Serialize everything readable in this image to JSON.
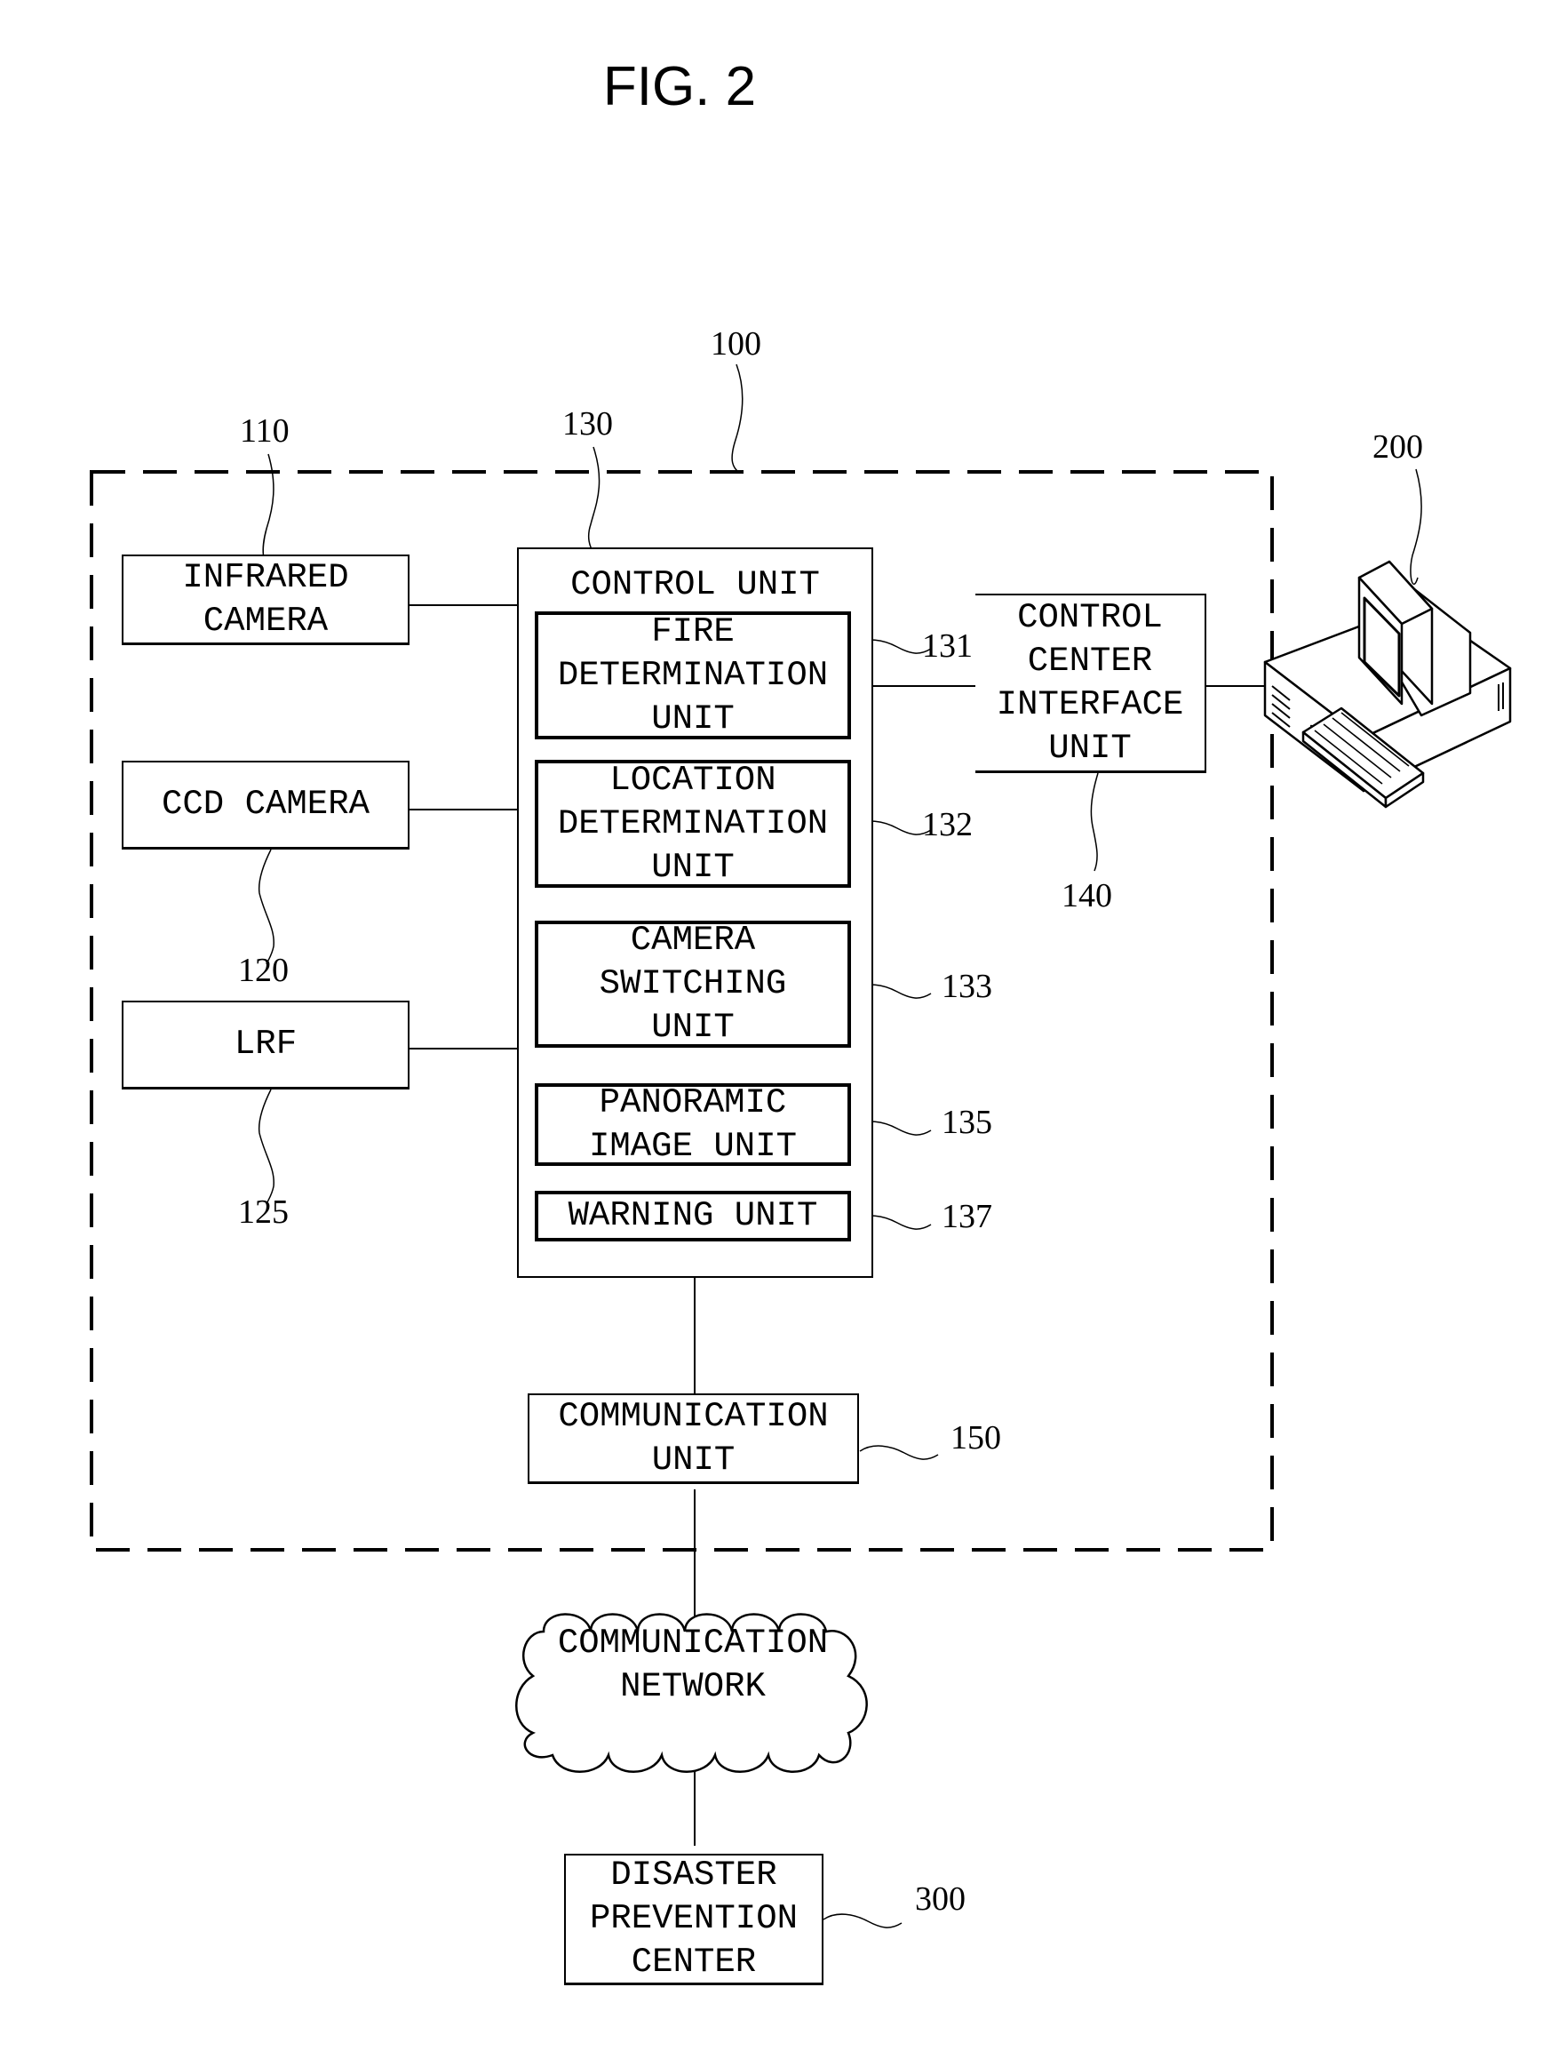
{
  "figure": {
    "title": "FIG. 2"
  },
  "system": {
    "ref": "100",
    "boundary": "dashed"
  },
  "components": {
    "infrared_camera": {
      "ref": "110",
      "lines": [
        "INFRARED",
        "CAMERA"
      ]
    },
    "ccd_camera": {
      "ref": "120",
      "lines": [
        "CCD CAMERA"
      ]
    },
    "lrf": {
      "ref": "125",
      "lines": [
        "LRF"
      ]
    },
    "control_unit": {
      "ref": "130",
      "label": "CONTROL UNIT",
      "subunits": [
        {
          "ref": "131",
          "lines": [
            "FIRE",
            "DETERMINATION",
            "UNIT"
          ]
        },
        {
          "ref": "132",
          "lines": [
            "LOCATION",
            "DETERMINATION",
            "UNIT"
          ]
        },
        {
          "ref": "133",
          "lines": [
            "CAMERA",
            "SWITCHING",
            "UNIT"
          ]
        },
        {
          "ref": "135",
          "lines": [
            "PANORAMIC",
            "IMAGE UNIT"
          ]
        },
        {
          "ref": "137",
          "lines": [
            "WARNING UNIT"
          ]
        }
      ]
    },
    "control_center_interface": {
      "ref": "140",
      "lines": [
        "CONTROL",
        "CENTER",
        "INTERFACE",
        "UNIT"
      ]
    },
    "communication_unit": {
      "ref": "150",
      "lines": [
        "COMMUNICATION",
        "UNIT"
      ]
    },
    "control_center_computer": {
      "ref": "200",
      "icon": "desktop-computer-icon"
    },
    "communication_network": {
      "lines": [
        "COMMUNICATION",
        "NETWORK"
      ],
      "icon": "cloud-icon"
    },
    "disaster_prevention_center": {
      "ref": "300",
      "lines": [
        "DISASTER",
        "PREVENTION",
        "CENTER"
      ]
    }
  },
  "connections": [
    [
      "infrared_camera",
      "control_unit"
    ],
    [
      "ccd_camera",
      "control_unit"
    ],
    [
      "lrf",
      "control_unit"
    ],
    [
      "control_unit",
      "control_center_interface"
    ],
    [
      "control_center_interface",
      "control_center_computer"
    ],
    [
      "control_unit",
      "communication_unit"
    ],
    [
      "communication_unit",
      "communication_network"
    ],
    [
      "communication_network",
      "disaster_prevention_center"
    ]
  ]
}
